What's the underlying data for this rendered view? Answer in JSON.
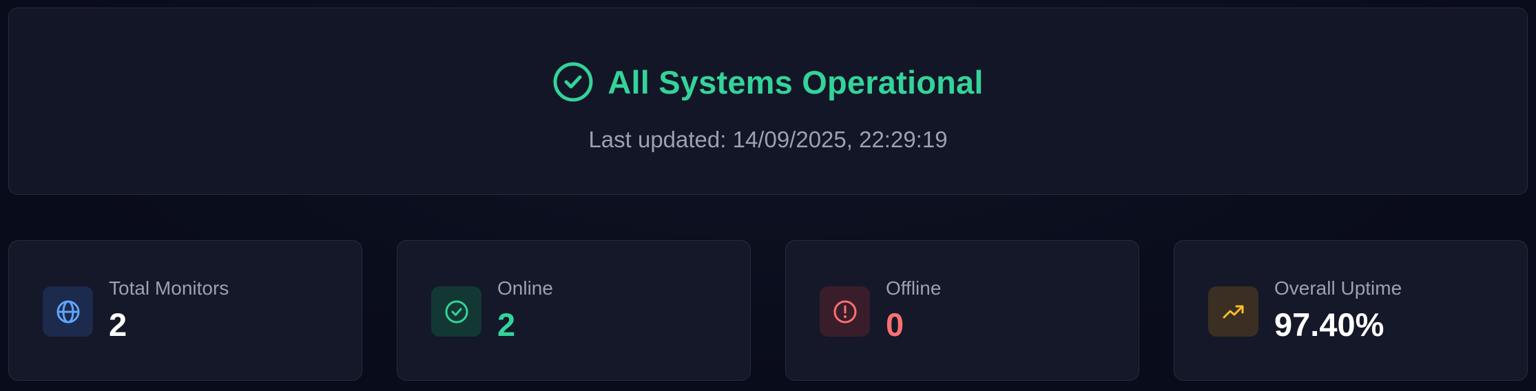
{
  "status": {
    "title": "All Systems Operational",
    "last_updated": "Last updated: 14/09/2025, 22:29:19",
    "icon": "check-circle-icon",
    "color": "#34d399"
  },
  "stats": [
    {
      "label": "Total Monitors",
      "value": "2",
      "icon": "globe-icon",
      "color": "#60a5fa"
    },
    {
      "label": "Online",
      "value": "2",
      "icon": "check-circle-icon",
      "color": "#34d399"
    },
    {
      "label": "Offline",
      "value": "0",
      "icon": "alert-circle-icon",
      "color": "#f87171"
    },
    {
      "label": "Overall Uptime",
      "value": "97.40%",
      "icon": "trending-up-icon",
      "color": "#fbbf24"
    }
  ]
}
